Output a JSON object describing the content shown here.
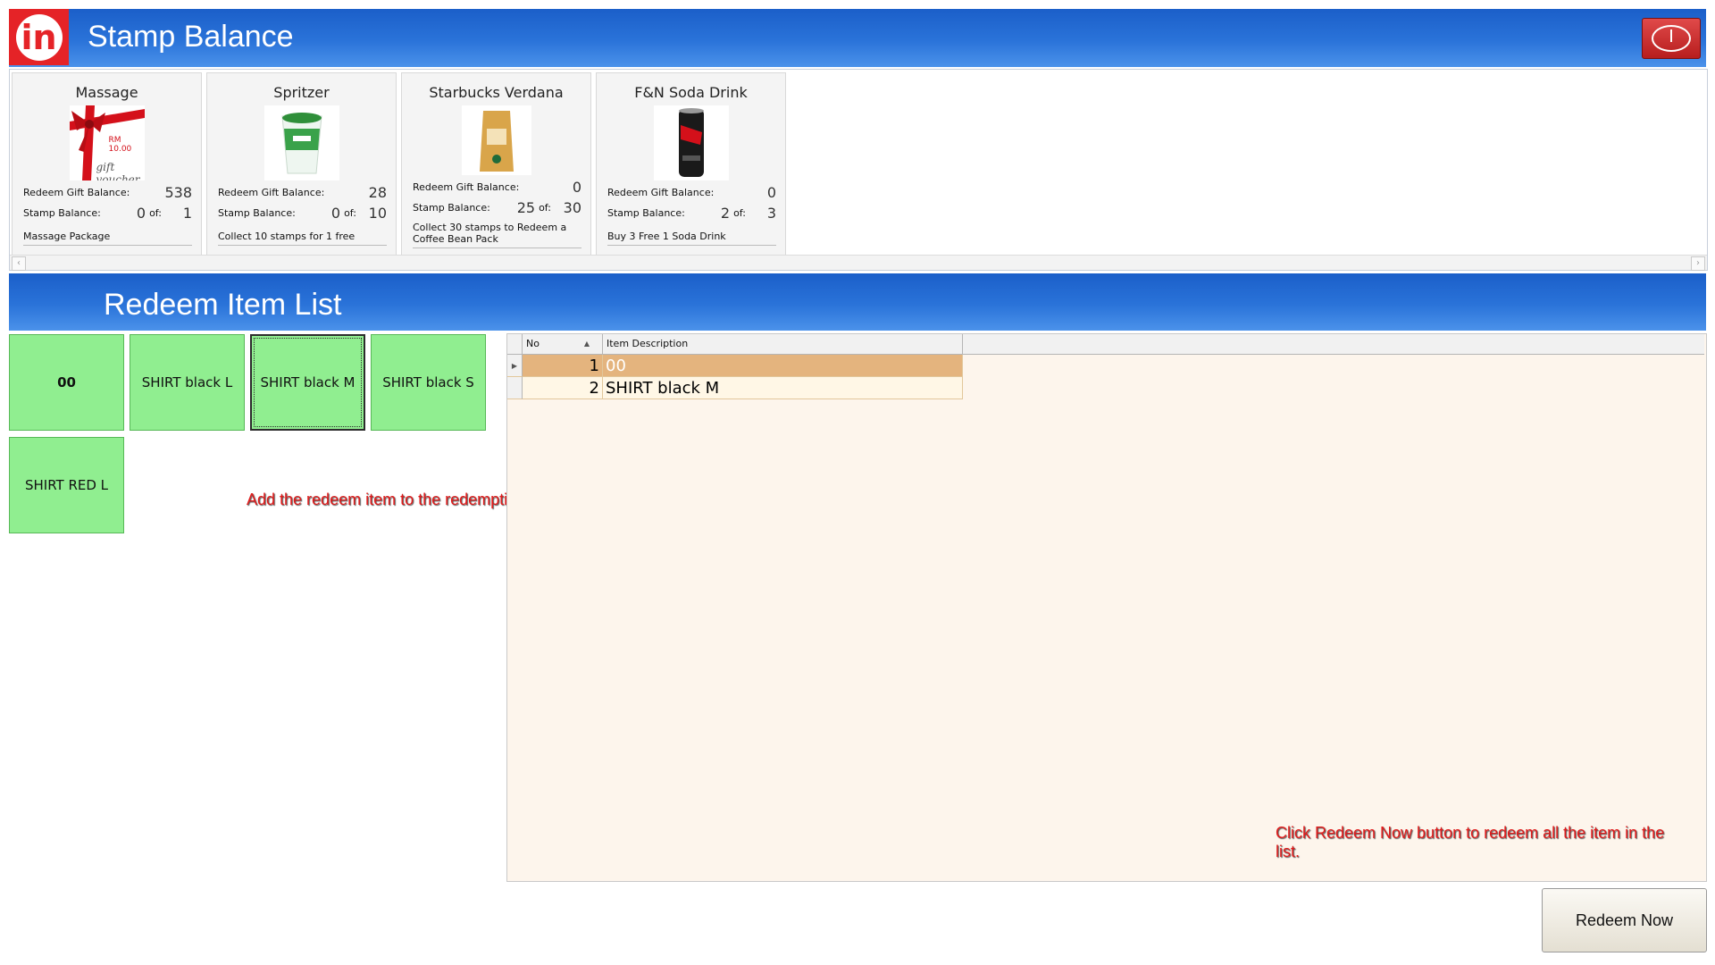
{
  "window": {
    "title": "Stamp Balance",
    "logo_text": "in"
  },
  "stamp_cards": [
    {
      "name": "Massage",
      "redeem_label": "Redeem Gift Balance:",
      "redeem_value": "538",
      "stamp_label": "Stamp Balance:",
      "stamp_value": "0",
      "of_label": "of:",
      "of_value": "1",
      "description": "Massage Package",
      "image_text": "RM 10.00",
      "image_text2": "gift voucher"
    },
    {
      "name": "Spritzer",
      "redeem_label": "Redeem Gift Balance:",
      "redeem_value": "28",
      "stamp_label": "Stamp Balance:",
      "stamp_value": "0",
      "of_label": "of:",
      "of_value": "10",
      "description": "Collect 10 stamps for 1 free"
    },
    {
      "name": "Starbucks Verdana",
      "redeem_label": "Redeem Gift Balance:",
      "redeem_value": "0",
      "stamp_label": "Stamp Balance:",
      "stamp_value": "25",
      "of_label": "of:",
      "of_value": "30",
      "description": "Collect 30 stamps to Redeem a Coffee Bean Pack"
    },
    {
      "name": "F&N Soda Drink",
      "redeem_label": "Redeem Gift Balance:",
      "redeem_value": "0",
      "stamp_label": "Stamp Balance:",
      "stamp_value": "2",
      "of_label": "of:",
      "of_value": "3",
      "description": "Buy 3 Free 1 Soda Drink"
    }
  ],
  "section": {
    "title": "Redeem Item List"
  },
  "redeem_items": [
    {
      "label": "00"
    },
    {
      "label": "SHIRT black L"
    },
    {
      "label": "SHIRT black M"
    },
    {
      "label": "SHIRT black S"
    },
    {
      "label": "SHIRT RED L"
    }
  ],
  "grid": {
    "columns": [
      "No",
      "Item Description"
    ],
    "rows": [
      {
        "no": "1",
        "desc": "00"
      },
      {
        "no": "2",
        "desc": "SHIRT black M"
      }
    ]
  },
  "notes": {
    "add_item": "Add the redeem item to the redemption list",
    "redeem_hint": "Click Redeem Now button to redeem all the item in the list."
  },
  "redeem_button": "Redeem Now",
  "colors": {
    "title_bar": "#2a73d9",
    "item_green": "#90ee90",
    "selected_row": "#e4b47e",
    "note_red": "#e01b1b"
  }
}
